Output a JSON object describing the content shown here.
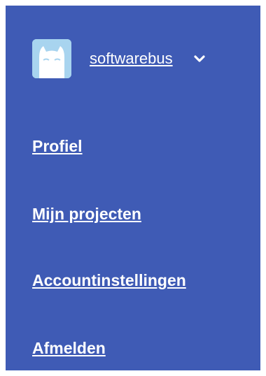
{
  "account": {
    "avatar_icon": "cat-avatar-icon",
    "username": "softwarebus",
    "dropdown_icon": "chevron-down-icon"
  },
  "menu": {
    "items": [
      {
        "label": "Profiel"
      },
      {
        "label": "Mijn projecten"
      },
      {
        "label": "Accountinstellingen"
      },
      {
        "label": "Afmelden"
      }
    ]
  },
  "colors": {
    "panel_background": "#3f5bb5",
    "text": "#ffffff",
    "avatar_background": "#a8d4ef"
  }
}
